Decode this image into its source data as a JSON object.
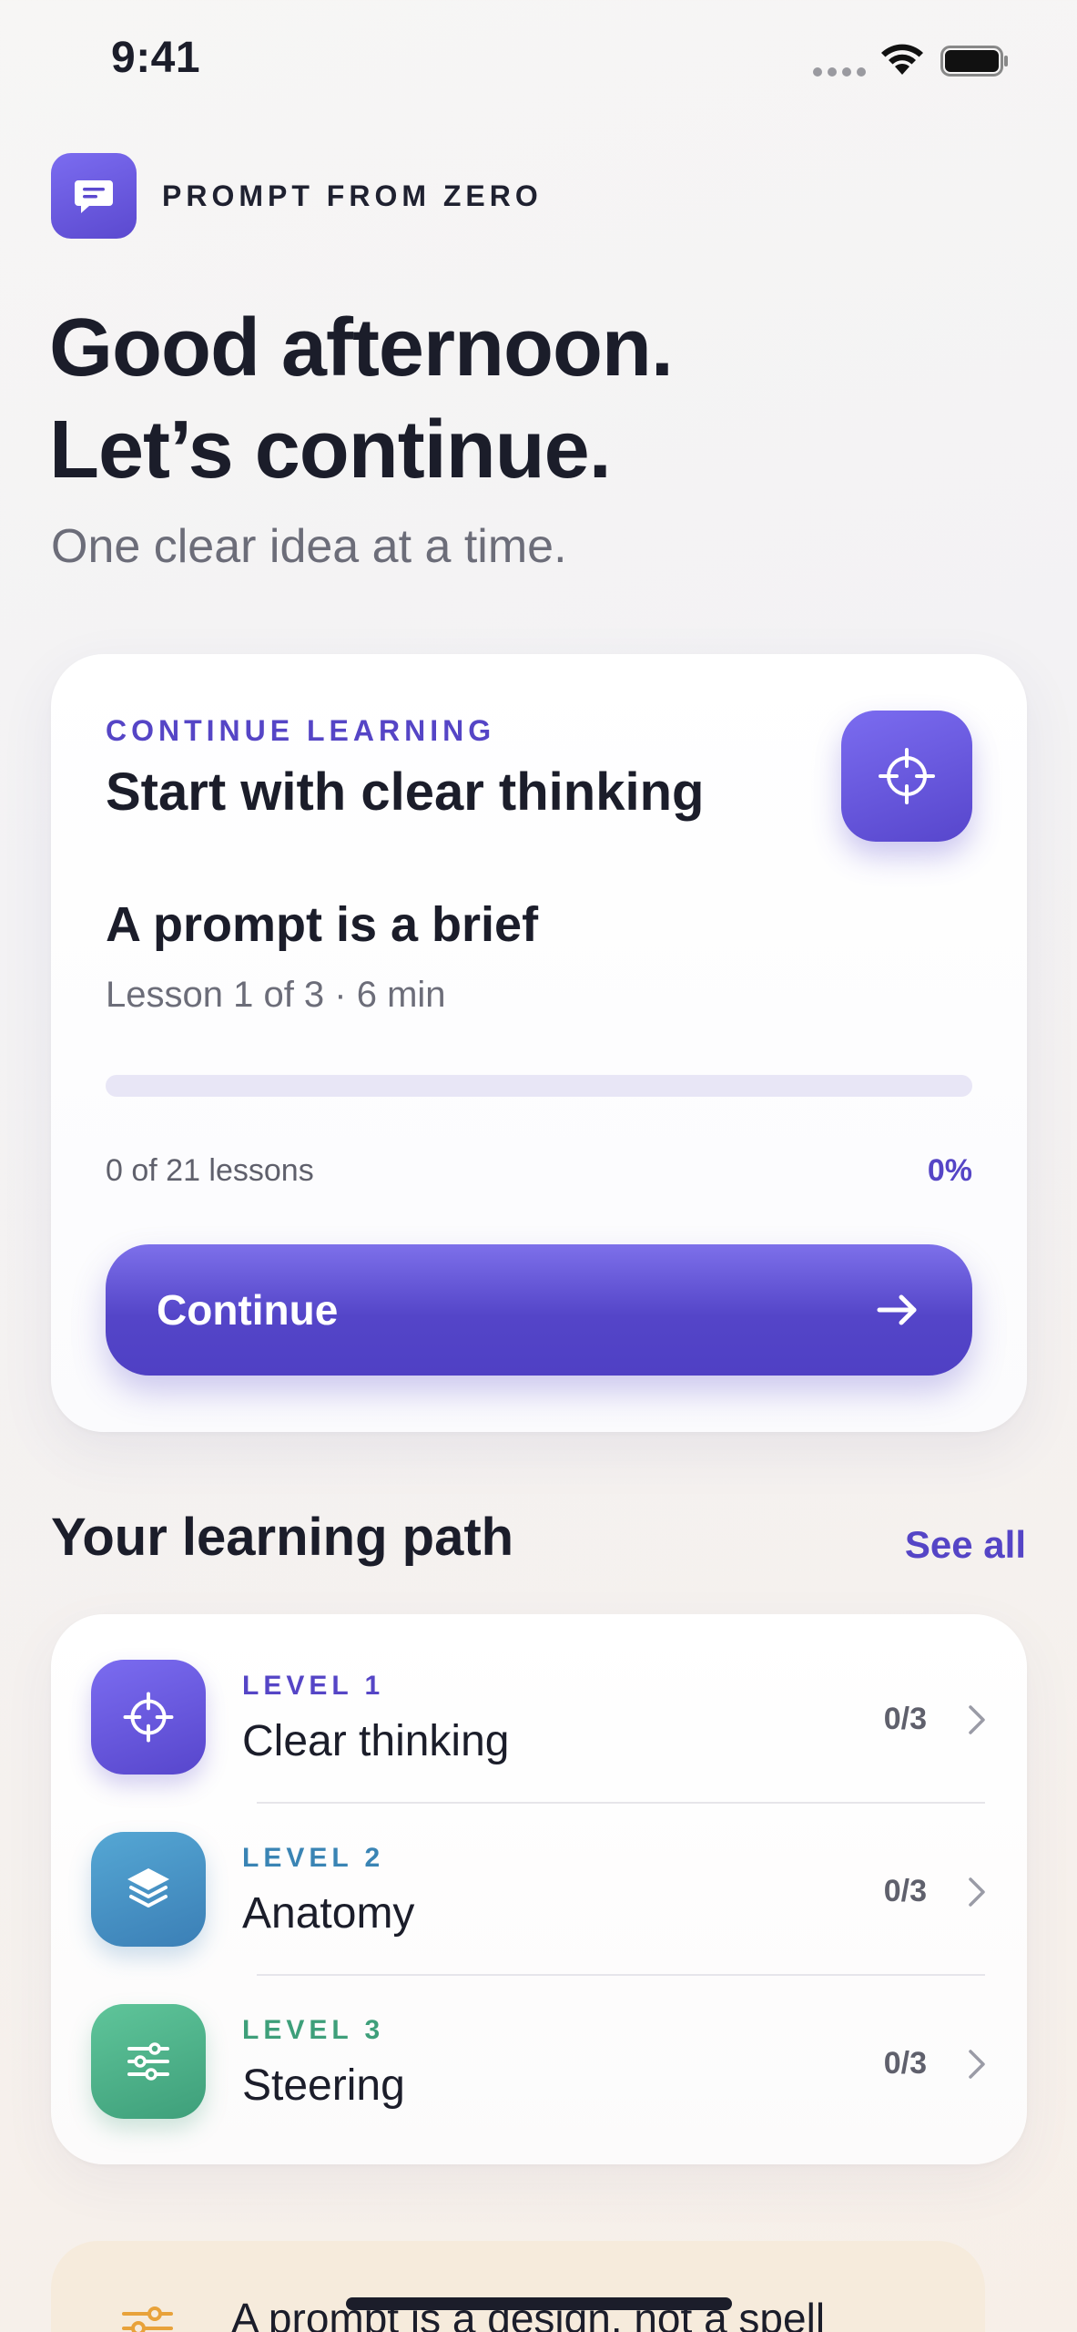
{
  "status_bar": {
    "time": "9:41"
  },
  "brand": {
    "name": "PROMPT FROM ZERO",
    "logo_icon": "chat-bubble-icon"
  },
  "greeting": {
    "line1": "Good afternoon.",
    "line2": "Let’s continue.",
    "subtitle": "One clear idea at a time."
  },
  "continue_card": {
    "kicker": "CONTINUE LEARNING",
    "title": "Start with clear thinking",
    "icon": "crosshair-icon",
    "lesson_title": "A prompt is a brief",
    "lesson_meta": "Lesson 1 of 3 · 6 min",
    "progress_fraction": 0,
    "progress_count": "0 of 21 lessons",
    "progress_percent": "0%",
    "button_label": "Continue"
  },
  "learning_path": {
    "title": "Your learning path",
    "see_all": "See all",
    "levels": [
      {
        "level": "LEVEL 1",
        "name": "Clear thinking",
        "count": "0/3",
        "icon": "crosshair-icon",
        "color": "#5545c6"
      },
      {
        "level": "LEVEL 2",
        "name": "Anatomy",
        "count": "0/3",
        "icon": "layers-icon",
        "color": "#3a84b4"
      },
      {
        "level": "LEVEL 3",
        "name": "Steering",
        "count": "0/3",
        "icon": "sliders-icon",
        "color": "#3e9f7a"
      }
    ]
  },
  "tip": {
    "text": "A prompt is a design, not a spell",
    "icon": "sliders-icon"
  },
  "colors": {
    "accent": "#5545c6",
    "blue": "#3a84b4",
    "green": "#3e9f7a",
    "tip_bg": "#f6ebdc"
  }
}
